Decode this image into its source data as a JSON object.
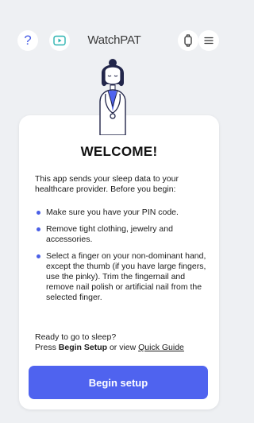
{
  "header": {
    "help_icon_label": "?",
    "logo_text": "WatchPAT"
  },
  "card": {
    "title": "WELCOME!",
    "intro": "This app sends your sleep data to your healthcare provider. Before you begin:",
    "bullets": [
      "Make sure you have your PIN code.",
      "Remove tight clothing, jewelry and accessories.",
      "Select a finger on your non-dominant hand, except the thumb (if you have large fingers, use the pinky). Trim the fingernail and remove nail polish or artificial nail from the selected finger."
    ],
    "ready_line": "Ready to go to sleep?",
    "press_prefix": "Press ",
    "press_bold": "Begin Setup",
    "press_middle": " or view ",
    "quick_guide_link": "Quick Guide",
    "begin_button": "Begin setup"
  },
  "colors": {
    "accent": "#4f63ef",
    "background": "#eef0f3"
  }
}
